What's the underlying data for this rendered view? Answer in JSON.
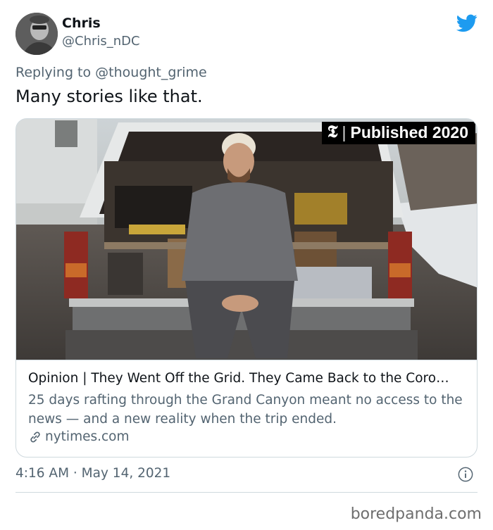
{
  "author": {
    "display_name": "Chris",
    "handle": "@Chris_nDC"
  },
  "brand_icon": "twitter-bird-icon",
  "colors": {
    "twitter_blue": "#1d9bf0",
    "secondary_text": "#536471",
    "primary_text": "#0f1419",
    "border": "#cfd9de"
  },
  "reply": {
    "prefix": "Replying to",
    "mention": "@thought_grime"
  },
  "tweet_text": "Many stories like that.",
  "card": {
    "image_badge": {
      "logo": "𝕿",
      "separator": "|",
      "text": "Published 2020"
    },
    "title": "Opinion | They Went Off the Grid. They Came Back to the Coro…",
    "description": "25 days rafting through the Grand Canyon meant no access to the news — and a new reality when the trip ended.",
    "domain_icon": "link-icon",
    "domain": "nytimes.com"
  },
  "timestamp": "4:16 AM · May 14, 2021",
  "info_icon": "info-icon",
  "watermark": "boredpanda.com"
}
